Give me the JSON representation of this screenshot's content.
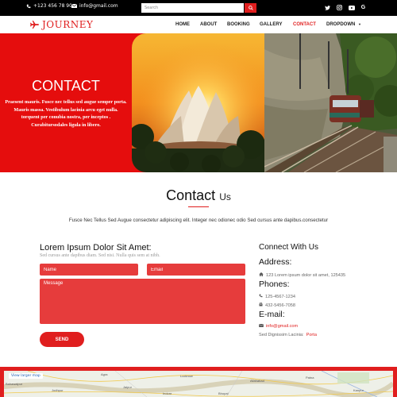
{
  "topbar": {
    "phone": "+123 456 78 90",
    "email": "info@gmail.com",
    "search_placeholder": "Search",
    "social": [
      "twitter-icon",
      "instagram-icon",
      "youtube-icon",
      "google-icon"
    ]
  },
  "nav": {
    "logo": "JOURNEY",
    "items": [
      "HOME",
      "ABOUT",
      "BOOKING",
      "GALLERY",
      "CONTACT",
      "DROPDOWN"
    ],
    "active": "CONTACT",
    "accent": "#e01e1e"
  },
  "hero": {
    "title": "CONTACT",
    "text": "Praesent mauris. Fusce nec tellus sed augue semper porta. Mauris massa. Vestibulum lacinia arcu eget nulla. torquent per conubia nostra, per inceptos . Curabitursodales ligula in libero.",
    "bg": "#e50d0d"
  },
  "contact_section": {
    "title_main": "Contact",
    "title_sub": "Us",
    "description": "Fusce Nec Tellus Sed Augue consectetur adipiscing elit. Integer nec odionec odio Sed cursus ante dapibus.consectetur"
  },
  "form": {
    "title": "Lorem Ipsum Dolor Sit Amet:",
    "subtitle": "Sed cursus ante dapibus diam. Sed nisi. Nulla quis sem at nibh.",
    "name_placeholder": "Name",
    "email_placeholder": "Email",
    "message_placeholder": "Message",
    "send_label": "SEND"
  },
  "connect": {
    "title": "Connect With Us",
    "address_label": "Address:",
    "address": "123 Lorem ipsum dolor sit amet, 125435",
    "phones_label": "Phones:",
    "phone1": "125-4567-1234",
    "phone2": "432-5456-7058",
    "email_label": "E-mail:",
    "email": "info@gmail.com",
    "extra_text": "Sed Dignissim Lacinia:",
    "extra_link": "Porta"
  },
  "map": {
    "view_larger": "View larger map",
    "labels": [
      "Bahawalpur",
      "Agra",
      "Lucknow",
      "Allahabad",
      "Patna",
      "Jodhpur",
      "Jaipur",
      "Bhopal",
      "Indore",
      "Kanpur"
    ]
  }
}
